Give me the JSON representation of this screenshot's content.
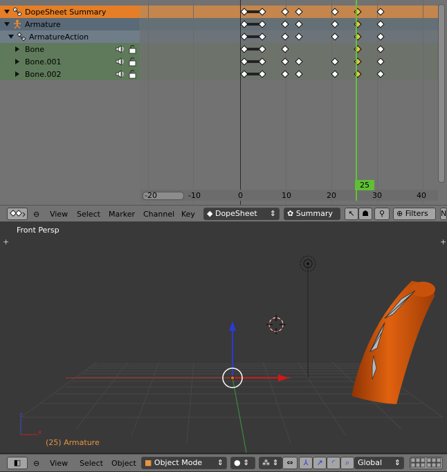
{
  "dopesheet": {
    "channels": [
      {
        "label": "DopeSheet Summary",
        "type": "summary"
      },
      {
        "label": "Armature",
        "type": "object"
      },
      {
        "label": "ArmatureAction",
        "type": "action"
      },
      {
        "label": "Bone",
        "type": "group"
      },
      {
        "label": "Bone.001",
        "type": "group"
      },
      {
        "label": "Bone.002",
        "type": "group"
      }
    ],
    "ruler_ticks": [
      "-20",
      "-10",
      "0",
      "10",
      "20",
      "30",
      "40"
    ],
    "current_frame": "25",
    "keyframes": {
      "summary": [
        0,
        4,
        9,
        12,
        20,
        25,
        30
      ],
      "armature": [
        0,
        4,
        9,
        12,
        20,
        25,
        30
      ],
      "action": [
        0,
        4,
        9,
        12,
        20,
        25,
        30
      ],
      "bone": [
        0,
        4,
        9,
        25,
        30
      ],
      "bone001": [
        0,
        4,
        9,
        12,
        20,
        25,
        30
      ],
      "bone002": [
        0,
        4,
        9,
        12,
        20,
        25,
        30
      ]
    }
  },
  "dopesheet_header": {
    "menus": [
      "View",
      "Select",
      "Marker",
      "Channel",
      "Key"
    ],
    "mode": "DopeSheet",
    "summary_label": "Summary",
    "filters_label": "Filters"
  },
  "viewport": {
    "title": "Front Persp",
    "object_label": "(25) Armature"
  },
  "viewport_header": {
    "menus": [
      "View",
      "Select",
      "Object"
    ],
    "mode": "Object Mode",
    "orientation": "Global"
  },
  "colors": {
    "summary_row": "#e57e26",
    "object_row": "#5a6a78",
    "action_row": "#6f7d89",
    "group_row": "#5f7a5a",
    "current_frame": "#5fbf35",
    "object_orange": "#d0560e"
  }
}
